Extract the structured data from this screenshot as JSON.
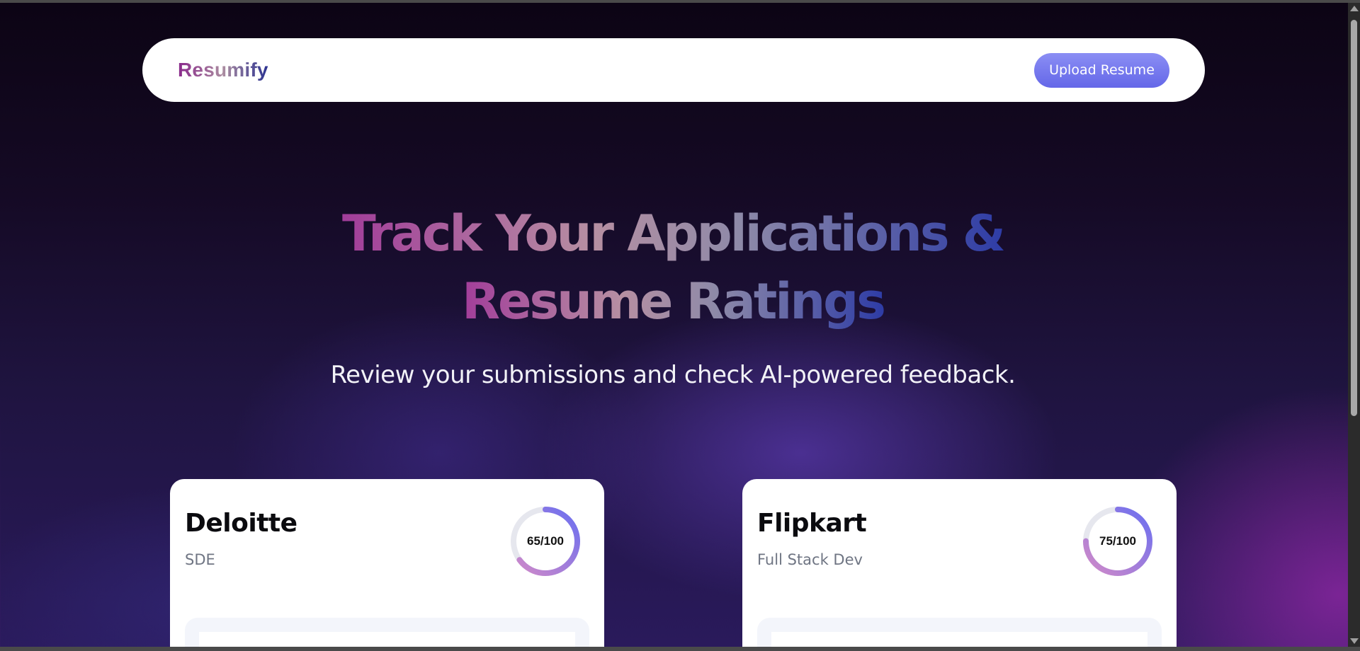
{
  "navbar": {
    "logo": "Resumify",
    "upload_button": "Upload Resume"
  },
  "hero": {
    "title_line1": "Track Your Applications &",
    "title_line2": "Resume Ratings",
    "subtitle": "Review your submissions and check AI-powered feedback."
  },
  "cards": [
    {
      "company": "Deloitte",
      "role": "SDE",
      "score_label": "65/100",
      "score": 65
    },
    {
      "company": "Flipkart",
      "role": "Full Stack Dev",
      "score_label": "75/100",
      "score": 75
    }
  ],
  "colors": {
    "accent": "#6467e8",
    "ring_start": "#d28ac8",
    "ring_end": "#6b6ff0",
    "ring_track": "#e6e7ee"
  },
  "icons": [
    "chevron-up-icon",
    "chevron-down-icon"
  ]
}
